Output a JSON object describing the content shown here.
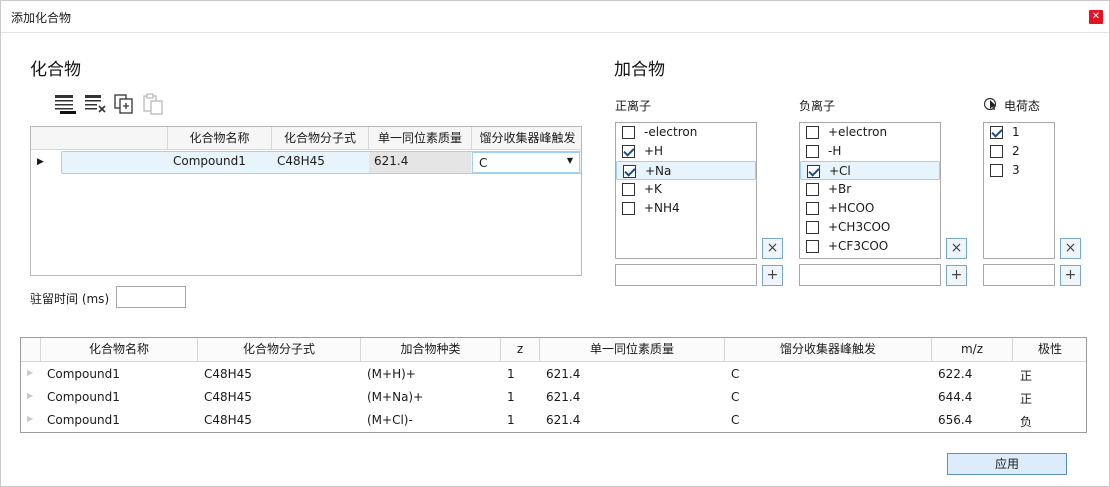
{
  "window": {
    "title": "添加化合物"
  },
  "compound_section": {
    "title": "化合物",
    "toolbar": [
      "add-row-icon",
      "delete-row-icon",
      "copy-icon",
      "paste-icon"
    ],
    "columns": [
      "化合物名称",
      "化合物分子式",
      "单一同位素质量",
      "馏分收集器峰触发"
    ],
    "row": {
      "name": "Compound1",
      "formula": "C48H45",
      "mass": "621.4",
      "trigger": "C"
    },
    "dwell_label": "驻留时间 (ms)",
    "dwell_value": ""
  },
  "adduct_section": {
    "title": "加合物",
    "positive": {
      "label": "正离子",
      "items": [
        {
          "text": "-electron",
          "checked": false
        },
        {
          "text": "+H",
          "checked": true
        },
        {
          "text": "+Na",
          "checked": true
        },
        {
          "text": "+K",
          "checked": false
        },
        {
          "text": "+NH4",
          "checked": false
        }
      ],
      "input": ""
    },
    "negative": {
      "label": "负离子",
      "items": [
        {
          "text": "+electron",
          "checked": false
        },
        {
          "text": "-H",
          "checked": false
        },
        {
          "text": "+Cl",
          "checked": true
        },
        {
          "text": "+Br",
          "checked": false
        },
        {
          "text": "+HCOO",
          "checked": false
        },
        {
          "text": "+CH3COO",
          "checked": false
        },
        {
          "text": "+CF3COO",
          "checked": false
        }
      ],
      "input": ""
    },
    "charge": {
      "label": "电荷态",
      "items": [
        {
          "text": "1",
          "checked": true
        },
        {
          "text": "2",
          "checked": false
        },
        {
          "text": "3",
          "checked": false
        }
      ],
      "input": ""
    },
    "remove_glyph": "×",
    "add_glyph": "+"
  },
  "results": {
    "columns": [
      "化合物名称",
      "化合物分子式",
      "加合物种类",
      "z",
      "单一同位素质量",
      "馏分收集器峰触发",
      "m/z",
      "极性"
    ],
    "rows": [
      [
        "Compound1",
        "C48H45",
        "(M+H)+",
        "1",
        "621.4",
        "C",
        "622.4",
        "正"
      ],
      [
        "Compound1",
        "C48H45",
        "(M+Na)+",
        "1",
        "621.4",
        "C",
        "644.4",
        "正"
      ],
      [
        "Compound1",
        "C48H45",
        "(M+Cl)-",
        "1",
        "621.4",
        "C",
        "656.4",
        "负"
      ]
    ]
  },
  "apply_label": "应用"
}
